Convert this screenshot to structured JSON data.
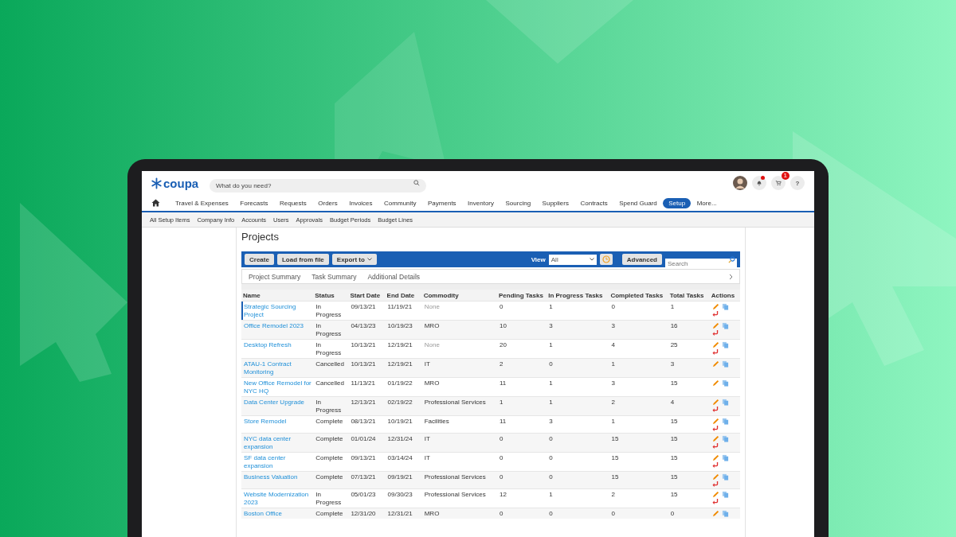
{
  "header": {
    "logo": "coupa",
    "search": {
      "placeholder": "What do you need?"
    },
    "notifications_unread": true,
    "cart_count": "1",
    "help": "?"
  },
  "nav": [
    {
      "label": "Travel & Expenses",
      "selected": false
    },
    {
      "label": "Forecasts",
      "selected": false
    },
    {
      "label": "Requests",
      "selected": false
    },
    {
      "label": "Orders",
      "selected": false
    },
    {
      "label": "Invoices",
      "selected": false
    },
    {
      "label": "Community",
      "selected": false
    },
    {
      "label": "Payments",
      "selected": false
    },
    {
      "label": "Inventory",
      "selected": false
    },
    {
      "label": "Sourcing",
      "selected": false
    },
    {
      "label": "Suppliers",
      "selected": false
    },
    {
      "label": "Contracts",
      "selected": false
    },
    {
      "label": "Spend Guard",
      "selected": false
    },
    {
      "label": "Setup",
      "selected": true
    },
    {
      "label": "More...",
      "selected": false
    }
  ],
  "subnav": [
    "All Setup Items",
    "Company Info",
    "Accounts",
    "Users",
    "Approvals",
    "Budget Periods",
    "Budget Lines"
  ],
  "page_title": "Projects",
  "toolbar": {
    "buttons": [
      "Create",
      "Load from file"
    ],
    "export": "Export to",
    "view_label": "View",
    "view_value": "All",
    "advanced": "Advanced",
    "search": {
      "placeholder": "Search"
    }
  },
  "tabs": [
    "Project Summary",
    "Task Summary",
    "Additional Details"
  ],
  "table": {
    "columns": [
      "Name",
      "Status",
      "Start Date",
      "End Date",
      "Commodity",
      "Pending Tasks",
      "In Progress Tasks",
      "Completed Tasks",
      "Total Tasks",
      "Actions"
    ],
    "rows": [
      {
        "name": "Strategic Sourcing Project",
        "status": "In Progress",
        "start": "09/13/21",
        "end": "11/19/21",
        "commodity": "None",
        "commodity_muted": true,
        "pending": "0",
        "in_progress": "1",
        "completed": "0",
        "total": "1",
        "restorable": true,
        "selected": true
      },
      {
        "name": "Office Remodel 2023",
        "status": "In Progress",
        "start": "04/13/23",
        "end": "10/19/23",
        "commodity": "MRO",
        "commodity_muted": false,
        "pending": "10",
        "in_progress": "3",
        "completed": "3",
        "total": "16",
        "restorable": true,
        "selected": false
      },
      {
        "name": "Desktop Refresh",
        "status": "In Progress",
        "start": "10/13/21",
        "end": "12/19/21",
        "commodity": "None",
        "commodity_muted": true,
        "pending": "20",
        "in_progress": "1",
        "completed": "4",
        "total": "25",
        "restorable": true,
        "selected": false
      },
      {
        "name": "ATAU-1 Contract Monitoring",
        "status": "Cancelled",
        "start": "10/13/21",
        "end": "12/19/21",
        "commodity": "IT",
        "commodity_muted": false,
        "pending": "2",
        "in_progress": "0",
        "completed": "1",
        "total": "3",
        "restorable": false,
        "selected": false
      },
      {
        "name": "New Office Remodel for NYC HQ",
        "status": "Cancelled",
        "start": "11/13/21",
        "end": "01/19/22",
        "commodity": "MRO",
        "commodity_muted": false,
        "pending": "11",
        "in_progress": "1",
        "completed": "3",
        "total": "15",
        "restorable": false,
        "selected": false
      },
      {
        "name": "Data Center Upgrade",
        "status": "In Progress",
        "start": "12/13/21",
        "end": "02/19/22",
        "commodity": "Professional Services",
        "commodity_muted": false,
        "pending": "1",
        "in_progress": "1",
        "completed": "2",
        "total": "4",
        "restorable": true,
        "selected": false
      },
      {
        "name": "Store Remodel",
        "status": "Complete",
        "start": "08/13/21",
        "end": "10/19/21",
        "commodity": "Facilities",
        "commodity_muted": false,
        "pending": "11",
        "in_progress": "3",
        "completed": "1",
        "total": "15",
        "restorable": true,
        "selected": false
      },
      {
        "name": "NYC data center expansion",
        "status": "Complete",
        "start": "01/01/24",
        "end": "12/31/24",
        "commodity": "IT",
        "commodity_muted": false,
        "pending": "0",
        "in_progress": "0",
        "completed": "15",
        "total": "15",
        "restorable": true,
        "selected": false
      },
      {
        "name": "SF data center expansion",
        "status": "Complete",
        "start": "09/13/21",
        "end": "03/14/24",
        "commodity": "IT",
        "commodity_muted": false,
        "pending": "0",
        "in_progress": "0",
        "completed": "15",
        "total": "15",
        "restorable": true,
        "selected": false
      },
      {
        "name": "Business Valuation",
        "status": "Complete",
        "start": "07/13/21",
        "end": "09/19/21",
        "commodity": "Professional Services",
        "commodity_muted": false,
        "pending": "0",
        "in_progress": "0",
        "completed": "15",
        "total": "15",
        "restorable": true,
        "selected": false
      },
      {
        "name": "Website Modernization 2023",
        "status": "In Progress",
        "start": "05/01/23",
        "end": "09/30/23",
        "commodity": "Professional Services",
        "commodity_muted": false,
        "pending": "12",
        "in_progress": "1",
        "completed": "2",
        "total": "15",
        "restorable": true,
        "selected": false
      },
      {
        "name": "Boston Office",
        "status": "Complete",
        "start": "12/31/20",
        "end": "12/31/21",
        "commodity": "MRO",
        "commodity_muted": false,
        "pending": "0",
        "in_progress": "0",
        "completed": "0",
        "total": "0",
        "restorable": false,
        "selected": false
      }
    ]
  }
}
